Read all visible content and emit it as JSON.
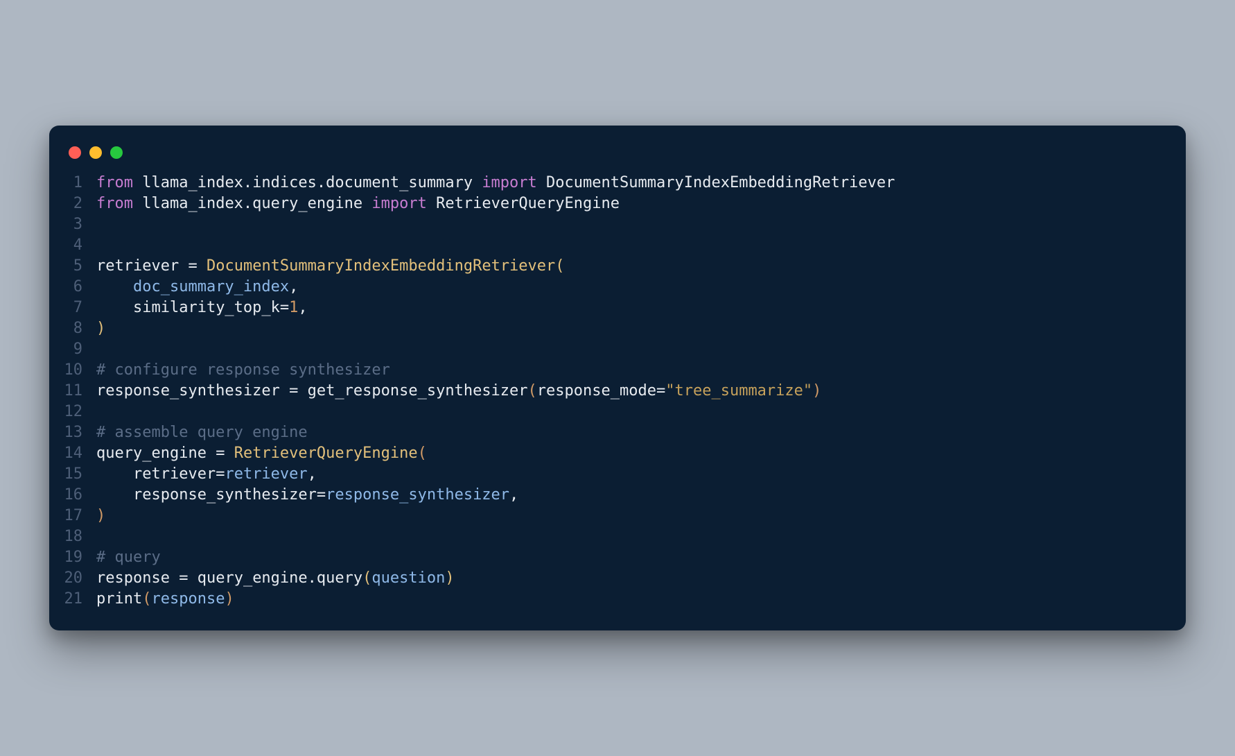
{
  "window": {
    "dots": {
      "red": "#ff5f56",
      "yellow": "#ffbd2e",
      "green": "#27c93f"
    }
  },
  "code": {
    "lines": [
      {
        "n": "1",
        "tokens": [
          [
            "kw",
            "from"
          ],
          [
            "txt",
            " "
          ],
          [
            "id",
            "llama_index.indices.document_summary"
          ],
          [
            "txt",
            " "
          ],
          [
            "kw",
            "import"
          ],
          [
            "txt",
            " "
          ],
          [
            "id",
            "DocumentSummaryIndexEmbeddingRetriever"
          ]
        ]
      },
      {
        "n": "2",
        "tokens": [
          [
            "kw",
            "from"
          ],
          [
            "txt",
            " "
          ],
          [
            "id",
            "llama_index.query_engine"
          ],
          [
            "txt",
            " "
          ],
          [
            "kw",
            "import"
          ],
          [
            "txt",
            " "
          ],
          [
            "id",
            "RetrieverQueryEngine"
          ]
        ]
      },
      {
        "n": "3",
        "tokens": []
      },
      {
        "n": "4",
        "tokens": []
      },
      {
        "n": "5",
        "tokens": [
          [
            "id",
            "retriever"
          ],
          [
            "txt",
            " "
          ],
          [
            "op",
            "="
          ],
          [
            "txt",
            " "
          ],
          [
            "cls",
            "DocumentSummaryIndexEmbeddingRetriever"
          ],
          [
            "pn",
            "("
          ]
        ]
      },
      {
        "n": "6",
        "tokens": [
          [
            "txt",
            "    "
          ],
          [
            "arg",
            "doc_summary_index"
          ],
          [
            "op",
            ","
          ]
        ]
      },
      {
        "n": "7",
        "tokens": [
          [
            "txt",
            "    "
          ],
          [
            "id",
            "similarity_top_k"
          ],
          [
            "op",
            "="
          ],
          [
            "num",
            "1"
          ],
          [
            "op",
            ","
          ]
        ]
      },
      {
        "n": "8",
        "tokens": [
          [
            "pn",
            ")"
          ]
        ]
      },
      {
        "n": "9",
        "tokens": []
      },
      {
        "n": "10",
        "tokens": [
          [
            "cm",
            "# configure response synthesizer"
          ]
        ]
      },
      {
        "n": "11",
        "tokens": [
          [
            "id",
            "response_synthesizer"
          ],
          [
            "txt",
            " "
          ],
          [
            "op",
            "="
          ],
          [
            "txt",
            " "
          ],
          [
            "fn",
            "get_response_synthesizer"
          ],
          [
            "brn",
            "("
          ],
          [
            "id",
            "response_mode"
          ],
          [
            "op",
            "="
          ],
          [
            "str",
            "\"tree_summarize\""
          ],
          [
            "brn",
            ")"
          ]
        ]
      },
      {
        "n": "12",
        "tokens": []
      },
      {
        "n": "13",
        "tokens": [
          [
            "cm",
            "# assemble query engine"
          ]
        ]
      },
      {
        "n": "14",
        "tokens": [
          [
            "id",
            "query_engine"
          ],
          [
            "txt",
            " "
          ],
          [
            "op",
            "="
          ],
          [
            "txt",
            " "
          ],
          [
            "cls",
            "RetrieverQueryEngine"
          ],
          [
            "brn",
            "("
          ]
        ]
      },
      {
        "n": "15",
        "tokens": [
          [
            "txt",
            "    "
          ],
          [
            "id",
            "retriever"
          ],
          [
            "op",
            "="
          ],
          [
            "arg",
            "retriever"
          ],
          [
            "op",
            ","
          ]
        ]
      },
      {
        "n": "16",
        "tokens": [
          [
            "txt",
            "    "
          ],
          [
            "id",
            "response_synthesizer"
          ],
          [
            "op",
            "="
          ],
          [
            "arg",
            "response_synthesizer"
          ],
          [
            "op",
            ","
          ]
        ]
      },
      {
        "n": "17",
        "tokens": [
          [
            "brn",
            ")"
          ]
        ]
      },
      {
        "n": "18",
        "tokens": []
      },
      {
        "n": "19",
        "tokens": [
          [
            "cm",
            "# query"
          ]
        ]
      },
      {
        "n": "20",
        "tokens": [
          [
            "id",
            "response"
          ],
          [
            "txt",
            " "
          ],
          [
            "op",
            "="
          ],
          [
            "txt",
            " "
          ],
          [
            "id",
            "query_engine"
          ],
          [
            "op",
            "."
          ],
          [
            "fn",
            "query"
          ],
          [
            "pn",
            "("
          ],
          [
            "arg",
            "question"
          ],
          [
            "pn",
            ")"
          ]
        ]
      },
      {
        "n": "21",
        "tokens": [
          [
            "fn",
            "print"
          ],
          [
            "brn",
            "("
          ],
          [
            "arg",
            "response"
          ],
          [
            "brn",
            ")"
          ]
        ]
      }
    ]
  }
}
